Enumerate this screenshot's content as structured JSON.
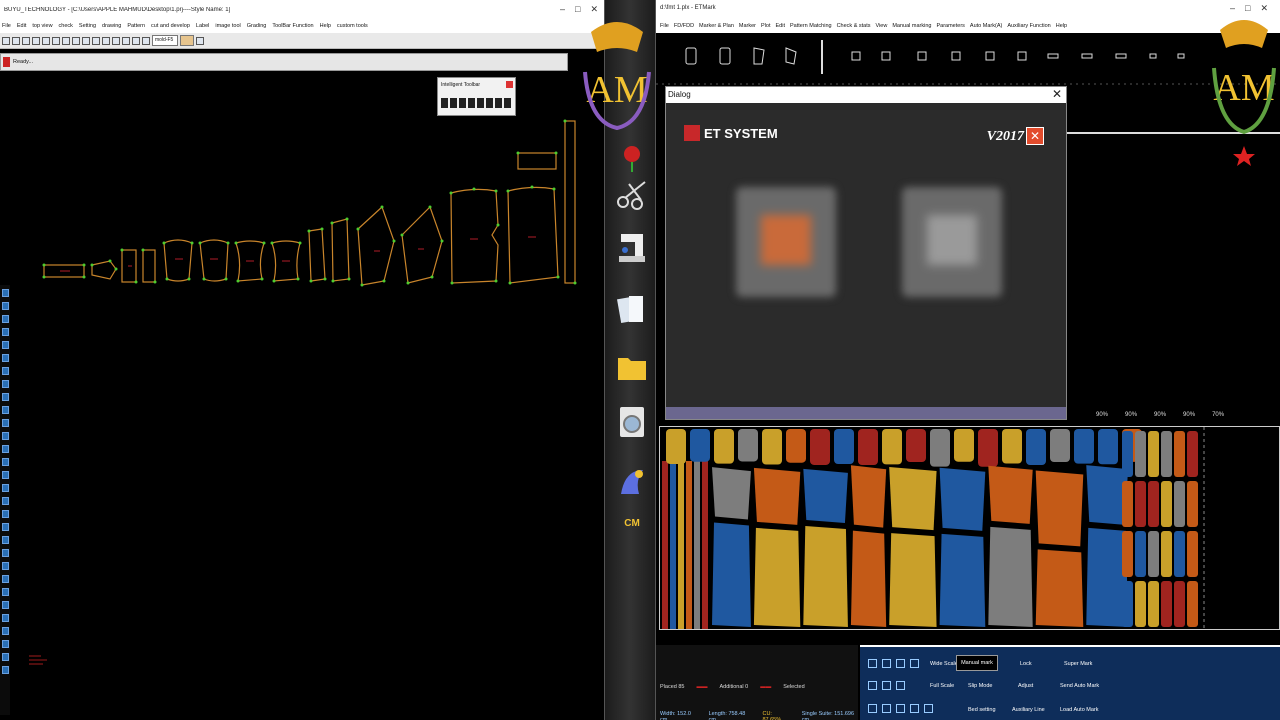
{
  "left_window": {
    "title": "BUYU_TECHNOLOGY - [C:\\Users\\APPLE MAHMUD\\Desktop\\1.prj----Style Name: 1]",
    "menu": [
      "File",
      "Edit",
      "top view",
      "check",
      "Setting",
      "drawing",
      "Pattern",
      "cut and develop",
      "Label",
      "image tool",
      "Grading",
      "ToolBar Function",
      "Help",
      "custom tools"
    ],
    "toolbar_select": "mold-F5",
    "status": "Ready...",
    "intelligent_toolbar": "Intelligent Toolbar"
  },
  "right_window": {
    "title": "d:\\fmt 1.plx - ETMark",
    "menu": [
      "File",
      "FD/FDD",
      "Marker & Plan",
      "Marker",
      "Plot",
      "Edit",
      "Pattern Matching",
      "Check & stats",
      "View",
      "Manual marking",
      "Parameters",
      "Auto Mark(A)",
      "Auxiliary Function",
      "Help"
    ]
  },
  "dialog": {
    "title": "Dialog",
    "logo": "ET SYSTEM",
    "version": "V2017"
  },
  "percent_labels": [
    "90%",
    "90%",
    "90%",
    "90%",
    "70%"
  ],
  "stats": {
    "placed": "Placed 85",
    "additional": "Additional 0",
    "selected": "Selected",
    "width": "Width: 152.0 cm",
    "length": "Length: 758.48 cm",
    "cu": "CU: 87.65%",
    "single_suite": "Single Suite: 151.696 cm"
  },
  "controls": {
    "wide_scale": "Wide Scale",
    "manual_mark": "Manual mark",
    "lock": "Lock",
    "super_mark": "Super Mark",
    "full_scale": "Full Scale",
    "slip_mode": "Slip Mode",
    "adjust": "Adjust",
    "send_auto_mark": "Send Auto Mark",
    "bed_setting": "Bed setting",
    "auxiliary_line": "Auxiliary Line",
    "load_auto_mark": "Load Auto Mark"
  },
  "dock_label": "CM",
  "colors": {
    "piece_outline": "#c9852b",
    "piece_points": "#4dcc2f",
    "marker_red": "#a0241f",
    "marker_blue": "#1f58a0",
    "marker_yellow": "#c9a02a",
    "marker_orange": "#c45a17",
    "marker_gray": "#7d7d7d",
    "control_panel": "#0e2d5a"
  }
}
